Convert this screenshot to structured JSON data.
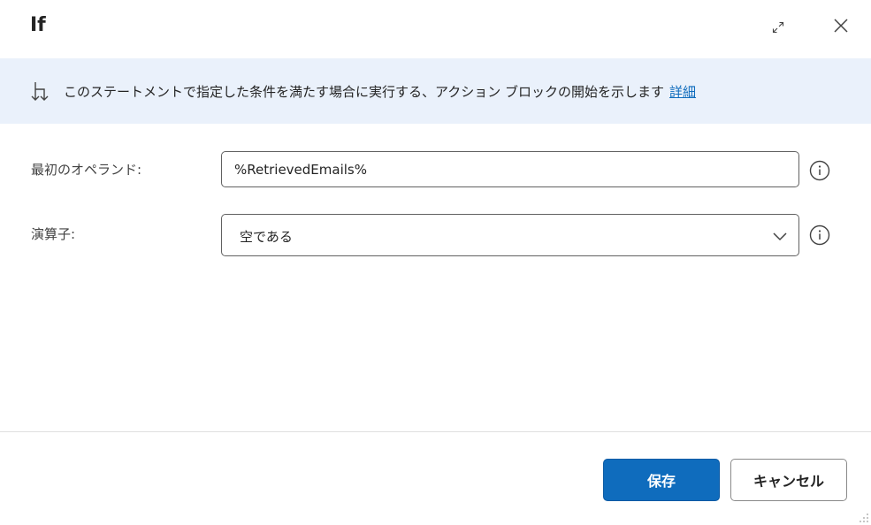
{
  "dialog": {
    "title": "If"
  },
  "banner": {
    "icon": "branch-down-arrow-icon",
    "text": "このステートメントで指定した条件を満たす場合に実行する、アクション ブロックの開始を示します",
    "link_text": "詳細"
  },
  "form": {
    "first_operand": {
      "label": "最初のオペランド:",
      "value": "%RetrievedEmails%"
    },
    "operator": {
      "label": "演算子:",
      "selected": "空である"
    }
  },
  "footer": {
    "save_label": "保存",
    "cancel_label": "キャンセル"
  },
  "colors": {
    "accent": "#0f6cbd",
    "banner_bg": "#eaf1fb",
    "link": "#0f6cbd"
  }
}
